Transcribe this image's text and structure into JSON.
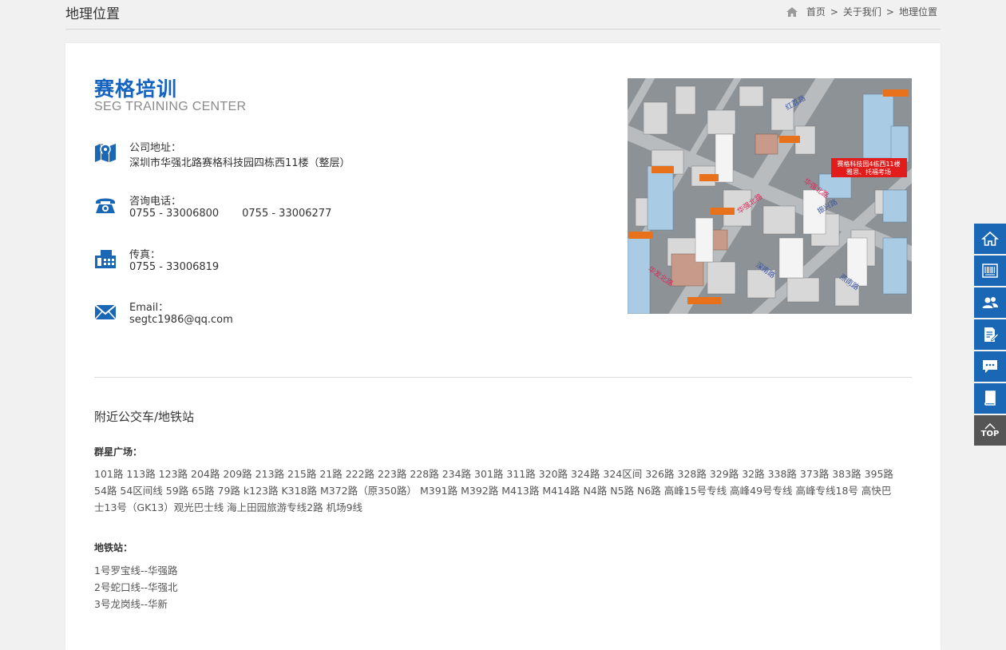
{
  "header": {
    "title": "地理位置",
    "breadcrumb": [
      "首页",
      "关于我们",
      "地理位置"
    ],
    "separator": ">"
  },
  "brand": {
    "name": "赛格培训",
    "english": "SEG TRAINING CENTER",
    "color": "#1565c0"
  },
  "contacts": [
    {
      "icon": "map-pin-icon",
      "label": "公司地址：",
      "value": "深圳市华强北路赛格科技园四栋西11楼（整层）"
    },
    {
      "icon": "phone-icon",
      "label": "咨询电话：",
      "value": "0755 - 33006800       0755 - 33006277"
    },
    {
      "icon": "fax-icon",
      "label": "传真：",
      "value": "0755 - 33006819"
    },
    {
      "icon": "mail-icon",
      "label": "Email：",
      "value": "segtc1986@qq.com"
    }
  ],
  "map": {
    "label_line1": "赛格科技园4栋西11楼",
    "label_line2": "雅思、托福考场",
    "roads": [
      "华强北路",
      "深南路",
      "红荔路",
      "振兴路",
      "华发北路",
      "燕南路"
    ]
  },
  "transit": {
    "section_title": "附近公交车/地铁站",
    "bus_heading": "群星广场：",
    "bus_routes": "101路  113路  123路  204路  209路    213路  215路  21路  222路  223路  228路  234路  301路  311路  320路  324路  324区间  326路  328路  329路  32路  338路  373路  383路  395路  54路  54区间线  59路  65路  79路  k123路  K318路  M372路（原350路）  M391路  M392路  M413路  M414路  N4路  N5路  N6路  高峰15号专线  高峰49号专线  高峰专线18号  高快巴士13号（GK13）观光巴士线  海上田园旅游专线2路  机场9线",
    "metro_heading": "地铁站：",
    "metro_lines": [
      "1号罗宝线--华强路",
      "2号蛇口线--华强北",
      "3号龙岗线--华新"
    ]
  },
  "sidebar": {
    "buttons": [
      "home-icon",
      "barcode-icon",
      "users-icon",
      "document-edit-icon",
      "chat-icon",
      "book-icon"
    ],
    "top_label": "TOP",
    "color": "#1a67b5"
  }
}
